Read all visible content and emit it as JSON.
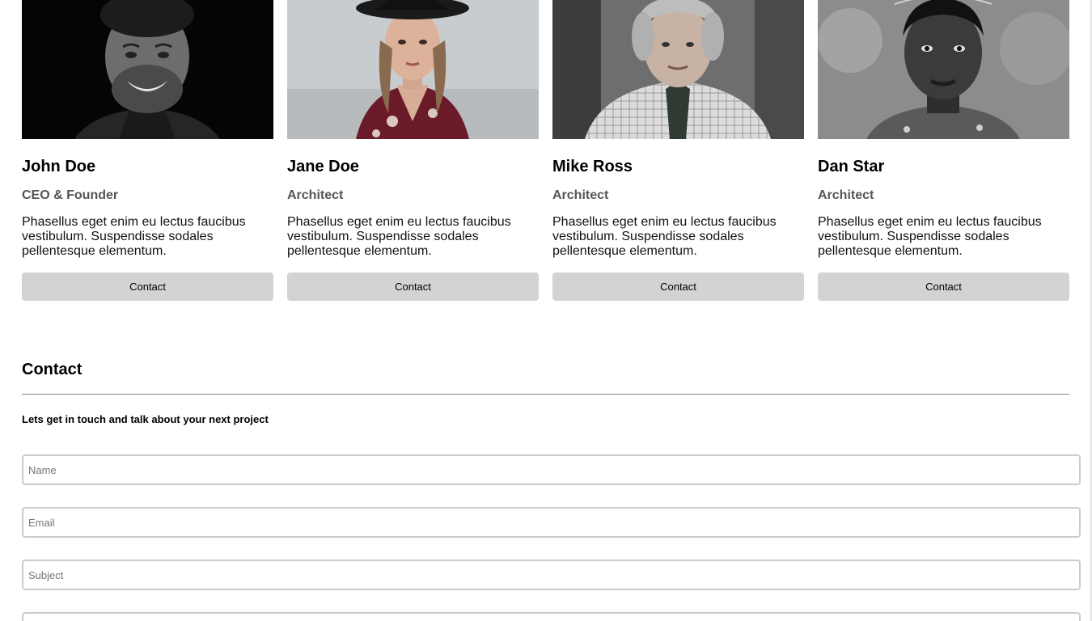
{
  "team": {
    "members": [
      {
        "name": "John Doe",
        "role": "CEO & Founder",
        "description": "Phasellus eget enim eu lectus faucibus vestibulum. Suspendisse sodales pellentesque elementum.",
        "button_label": "Contact"
      },
      {
        "name": "Jane Doe",
        "role": "Architect",
        "description": "Phasellus eget enim eu lectus faucibus vestibulum. Suspendisse sodales pellentesque elementum.",
        "button_label": "Contact"
      },
      {
        "name": "Mike Ross",
        "role": "Architect",
        "description": "Phasellus eget enim eu lectus faucibus vestibulum. Suspendisse sodales pellentesque elementum.",
        "button_label": "Contact"
      },
      {
        "name": "Dan Star",
        "role": "Architect",
        "description": "Phasellus eget enim eu lectus faucibus vestibulum. Suspendisse sodales pellentesque elementum.",
        "button_label": "Contact"
      }
    ]
  },
  "contact": {
    "title": "Contact",
    "subtitle": "Lets get in touch and talk about your next project",
    "fields": {
      "name_placeholder": "Name",
      "email_placeholder": "Email",
      "subject_placeholder": "Subject",
      "message_placeholder": ""
    }
  },
  "colors": {
    "button_bg": "#d3d3d3",
    "role_text": "#555555",
    "divider": "#888888",
    "input_border": "#cccccc"
  }
}
